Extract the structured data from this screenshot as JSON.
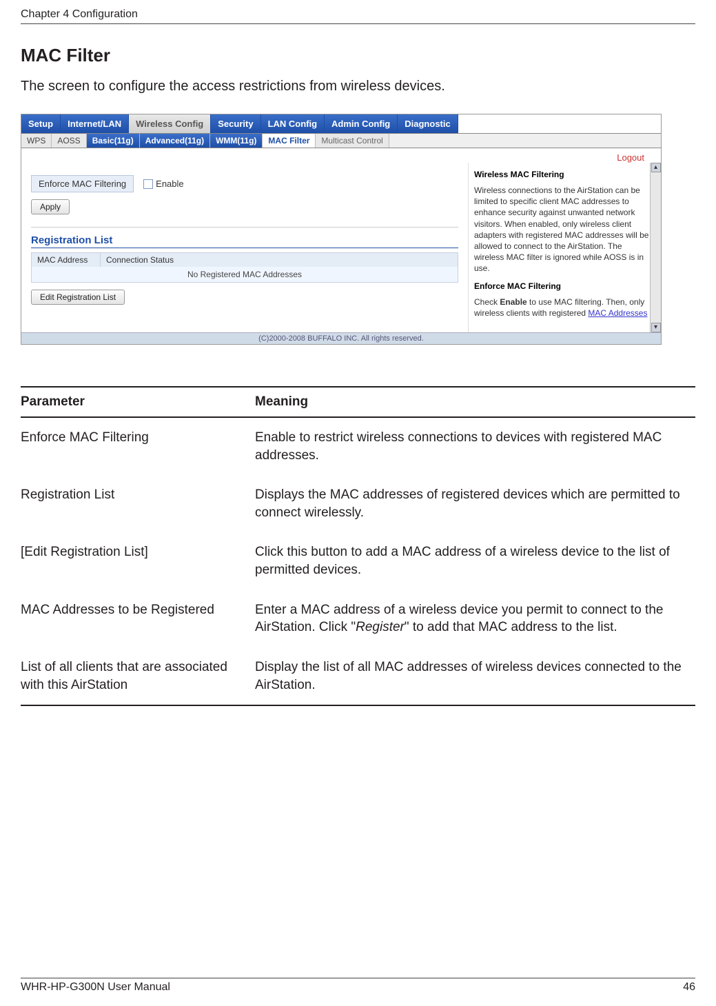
{
  "header": {
    "chapter": "Chapter 4  Configuration"
  },
  "section": {
    "title": "MAC Filter",
    "description": "The screen to configure the access restrictions from wireless devices."
  },
  "screenshot": {
    "main_tabs": {
      "setup": "Setup",
      "internet_lan": "Internet/LAN",
      "wireless_config": "Wireless Config",
      "security": "Security",
      "lan_config": "LAN Config",
      "admin_config": "Admin Config",
      "diagnostic": "Diagnostic"
    },
    "sub_tabs": {
      "wps": "WPS",
      "aoss": "AOSS",
      "basic": "Basic(11g)",
      "advanced": "Advanced(11g)",
      "wmm": "WMM(11g)",
      "mac_filter": "MAC Filter",
      "multicast": "Multicast Control"
    },
    "logout": "Logout",
    "form": {
      "enforce_label": "Enforce MAC Filtering",
      "enable_label": "Enable",
      "apply": "Apply"
    },
    "reg_list": {
      "title": "Registration List",
      "col_mac": "MAC Address",
      "col_status": "Connection Status",
      "empty": "No Registered MAC Addresses",
      "edit_btn": "Edit Registration List"
    },
    "help": {
      "title1": "Wireless MAC Filtering",
      "body1": "Wireless connections to the AirStation can be limited to specific client MAC addresses to enhance security against unwanted network visitors. When enabled, only wireless client adapters with registered MAC addresses will be allowed to connect to the AirStation. The wireless MAC filter is ignored while AOSS is in use.",
      "title2": "Enforce MAC Filtering",
      "body2_prefix": "Check ",
      "body2_bold": "Enable",
      "body2_mid": " to use MAC filtering. Then, only wireless clients with registered ",
      "body2_link": "MAC Addresses"
    },
    "footer": "(C)2000-2008 BUFFALO INC. All rights reserved."
  },
  "params": {
    "header_param": "Parameter",
    "header_meaning": "Meaning",
    "rows": [
      {
        "param": "Enforce MAC Filtering",
        "meaning": "Enable to restrict wireless connections to devices with registered MAC addresses."
      },
      {
        "param": "Registration List",
        "meaning": "Displays the MAC addresses of registered devices which are permitted to connect wirelessly."
      },
      {
        "param": "[Edit Registration List]",
        "meaning": "Click this button to add a MAC address of a wireless device to the list of permitted devices."
      },
      {
        "param": "MAC Addresses to be Registered",
        "meaning_prefix": "Enter a MAC address of a wireless device you permit to connect to the AirStation. Click \"",
        "meaning_italic": "Register",
        "meaning_suffix": "\" to add that MAC address to the list."
      },
      {
        "param": "List of all clients that are associated with this AirStation",
        "meaning": "Display the list of all MAC addresses of wireless devices connected to the AirStation."
      }
    ]
  },
  "footer": {
    "manual": "WHR-HP-G300N User Manual",
    "page": "46"
  }
}
